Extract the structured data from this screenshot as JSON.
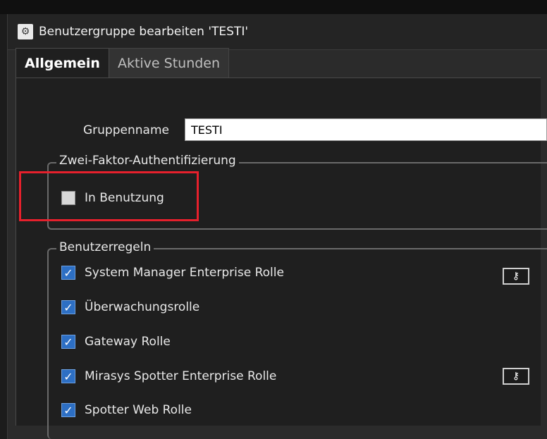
{
  "window": {
    "title": "Benutzergruppe bearbeiten 'TESTI'",
    "icon": "gear-icon"
  },
  "tabs": [
    {
      "label": "Allgemein",
      "active": true
    },
    {
      "label": "Aktive Stunden",
      "active": false
    }
  ],
  "general": {
    "group_name_label": "Gruppenname",
    "group_name_value": "TESTI"
  },
  "two_factor": {
    "legend": "Zwei-Faktor-Authentifizierung",
    "in_use_label": "In Benutzung",
    "in_use_checked": false
  },
  "user_rules": {
    "legend": "Benutzerregeln",
    "items": [
      {
        "label": "System Manager Enterprise Rolle",
        "checked": true,
        "has_key_button": true
      },
      {
        "label": "Überwachungsrolle",
        "checked": true,
        "has_key_button": false
      },
      {
        "label": "Gateway Rolle",
        "checked": true,
        "has_key_button": false
      },
      {
        "label": "Mirasys Spotter Enterprise Rolle",
        "checked": true,
        "has_key_button": true
      },
      {
        "label": "Spotter Web Rolle",
        "checked": true,
        "has_key_button": false
      }
    ]
  },
  "annotation": {
    "highlight_color": "#e6202c"
  },
  "colors": {
    "checkbox_checked": "#2d6fc4",
    "background": "#1f1f1f"
  }
}
